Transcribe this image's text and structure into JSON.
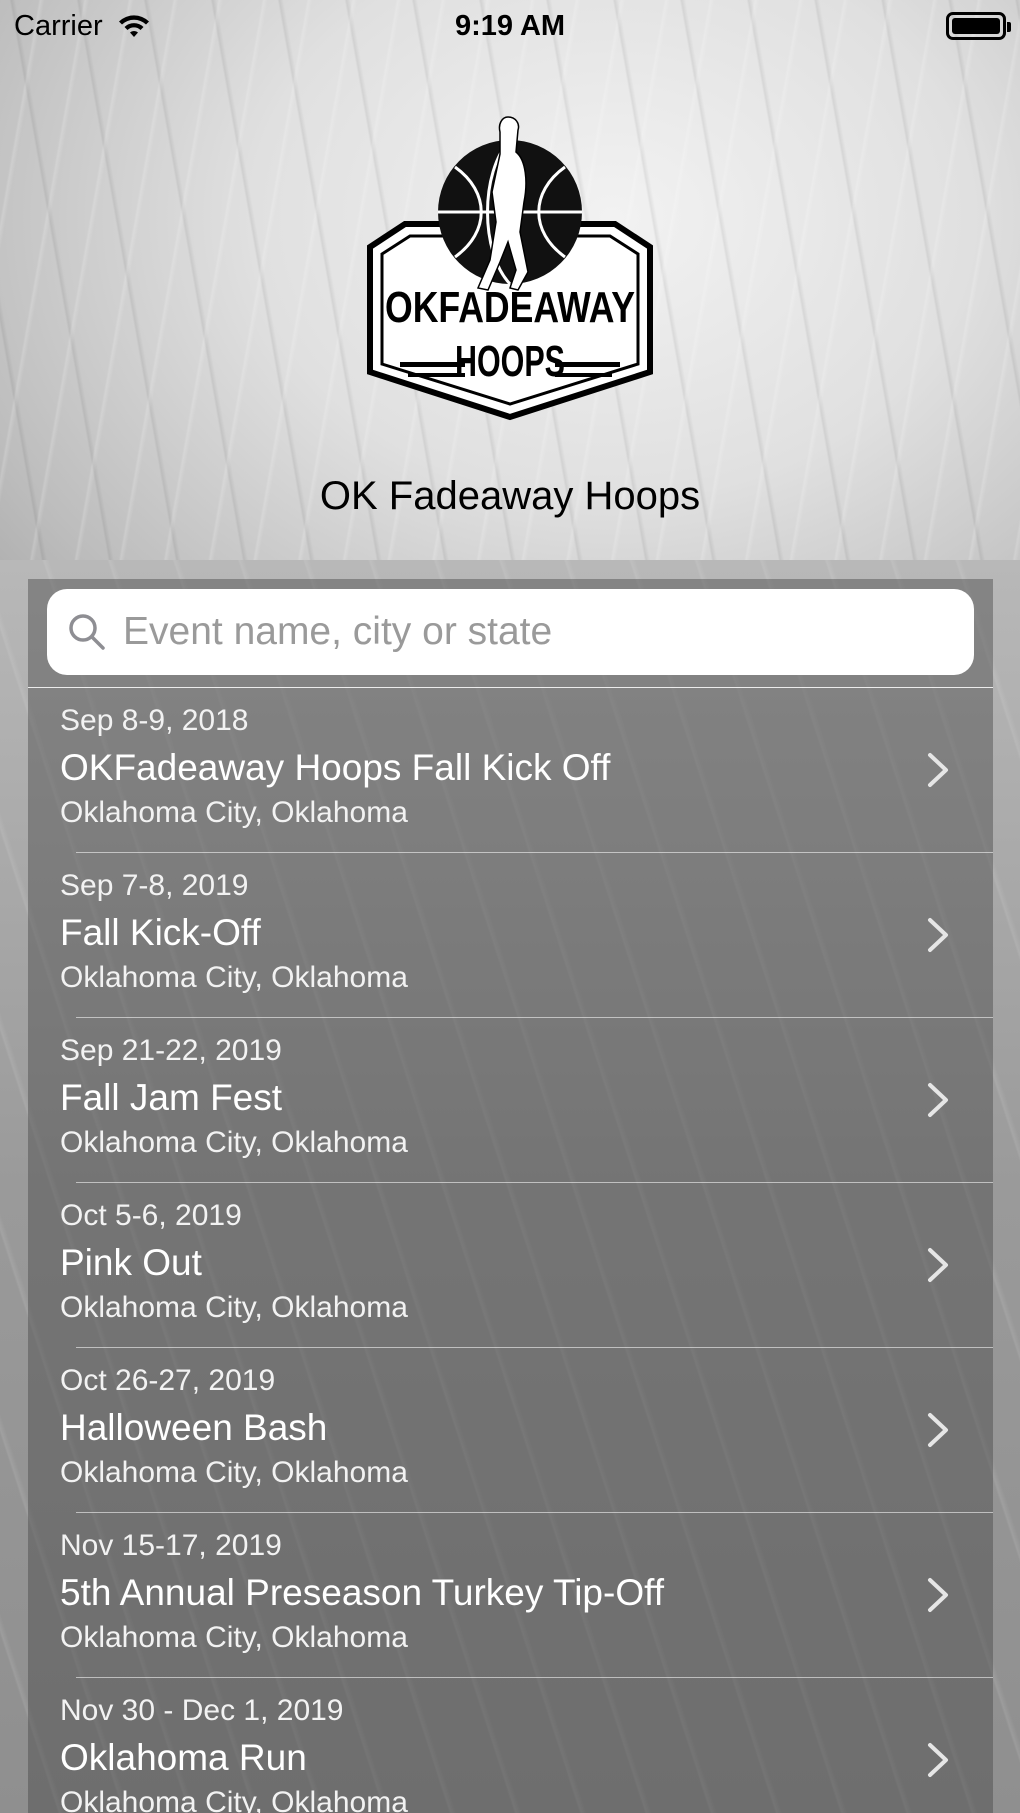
{
  "status_bar": {
    "carrier": "Carrier",
    "time": "9:19 AM"
  },
  "header": {
    "logo_text_line1": "OKFADEAWAY",
    "logo_text_line2": "HOOPS",
    "organization_name": "OK Fadeaway Hoops"
  },
  "search": {
    "placeholder": "Event name, city or state",
    "value": ""
  },
  "events": [
    {
      "date": "Sep 8-9, 2018",
      "name": "OKFadeaway Hoops Fall Kick Off",
      "location": "Oklahoma City, Oklahoma"
    },
    {
      "date": "Sep 7-8, 2019",
      "name": "Fall Kick-Off",
      "location": "Oklahoma City, Oklahoma"
    },
    {
      "date": "Sep 21-22, 2019",
      "name": "Fall Jam Fest",
      "location": "Oklahoma City, Oklahoma"
    },
    {
      "date": "Oct 5-6, 2019",
      "name": "Pink Out",
      "location": "Oklahoma City, Oklahoma"
    },
    {
      "date": "Oct 26-27, 2019",
      "name": "Halloween Bash",
      "location": "Oklahoma City, Oklahoma"
    },
    {
      "date": "Nov 15-17, 2019",
      "name": "5th Annual Preseason Turkey Tip-Off",
      "location": "Oklahoma City, Oklahoma"
    },
    {
      "date": "Nov 30 - Dec 1, 2019",
      "name": "Oklahoma Run",
      "location": "Oklahoma City, Oklahoma"
    }
  ],
  "icons": {
    "wifi": "wifi-icon",
    "battery": "battery-icon",
    "search": "search-icon",
    "chevron": "chevron-right-icon"
  },
  "colors": {
    "text_primary": "#000000",
    "row_text": "#ffffff",
    "panel_overlay": "#464646"
  }
}
